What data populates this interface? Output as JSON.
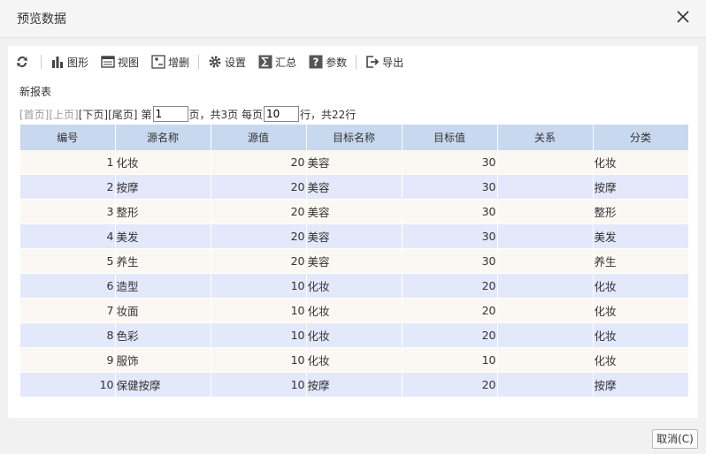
{
  "dialog": {
    "title": "预览数据",
    "cancel_label": "取消(C)"
  },
  "toolbar": {
    "refresh_icon": "refresh-icon",
    "chart_label": "图形",
    "view_label": "视图",
    "adddel_label": "增删",
    "settings_label": "设置",
    "summary_label": "汇总",
    "params_label": "参数",
    "export_label": "导出"
  },
  "report": {
    "name": "新报表"
  },
  "pager": {
    "first": "[首页]",
    "prev": "[上页]",
    "next": "[下页]",
    "last": "[尾页]",
    "page_prefix": "第",
    "page_value": "1",
    "page_suffix": "页，共3页 每页",
    "per_page_value": "10",
    "total_suffix": "行，共22行"
  },
  "table": {
    "headers": [
      "编号",
      "源名称",
      "源值",
      "目标名称",
      "目标值",
      "关系",
      "分类"
    ],
    "rows": [
      [
        "1",
        "化妆",
        "20",
        "美容",
        "30",
        "",
        "化妆"
      ],
      [
        "2",
        "按摩",
        "20",
        "美容",
        "30",
        "",
        "按摩"
      ],
      [
        "3",
        "整形",
        "20",
        "美容",
        "30",
        "",
        "整形"
      ],
      [
        "4",
        "美发",
        "20",
        "美容",
        "30",
        "",
        "美发"
      ],
      [
        "5",
        "养生",
        "20",
        "美容",
        "30",
        "",
        "养生"
      ],
      [
        "6",
        "造型",
        "10",
        "化妆",
        "20",
        "",
        "化妆"
      ],
      [
        "7",
        "妆面",
        "10",
        "化妆",
        "20",
        "",
        "化妆"
      ],
      [
        "8",
        "色彩",
        "10",
        "化妆",
        "20",
        "",
        "化妆"
      ],
      [
        "9",
        "服饰",
        "10",
        "化妆",
        "10",
        "",
        "化妆"
      ],
      [
        "10",
        "保健按摩",
        "10",
        "按摩",
        "20",
        "",
        "按摩"
      ]
    ]
  }
}
